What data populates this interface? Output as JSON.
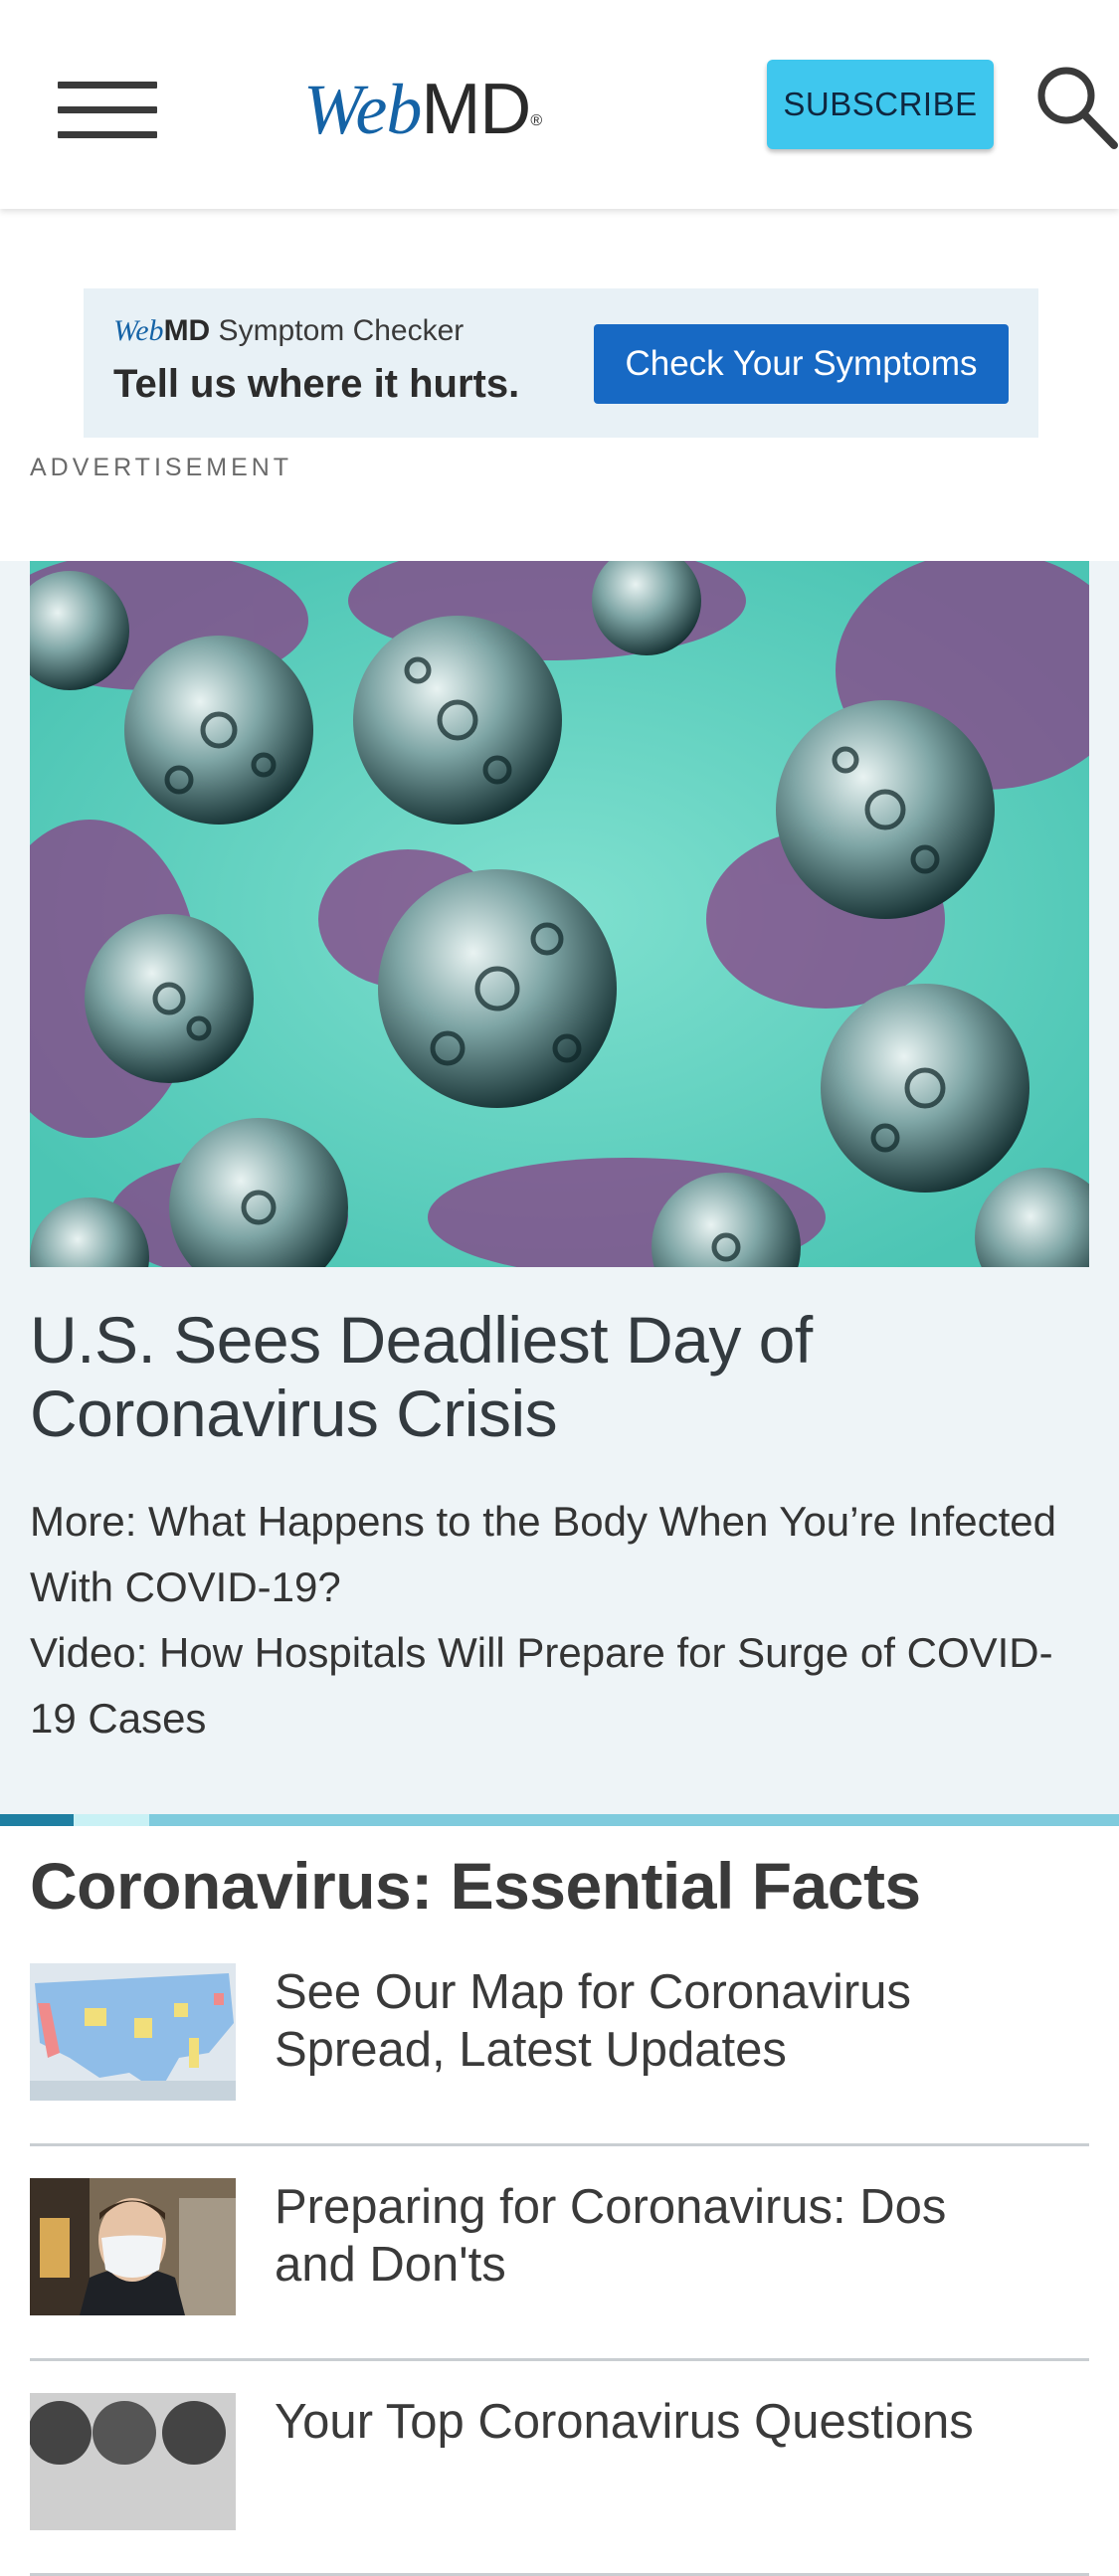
{
  "header": {
    "logo_web": "Web",
    "logo_md": "MD",
    "logo_reg": "®",
    "subscribe_label": "SUBSCRIBE"
  },
  "ad": {
    "brand_web": "Web",
    "brand_md": "MD",
    "brand_suffix": " Symptom Checker",
    "tagline": "Tell us where it hurts.",
    "cta": "Check Your Symptoms",
    "label": "ADVERTISEMENT"
  },
  "hero": {
    "title": "U.S. Sees Deadliest Day of Coronavirus Crisis",
    "links": [
      "More: What Happens to the Body When You’re Infected With COVID-19?",
      "Video: How Hospitals Will Prepare for Surge of COVID-19 Cases"
    ]
  },
  "essential_facts": {
    "title": "Coronavirus: Essential Facts",
    "items": [
      {
        "text": "See Our Map for Coronavirus Spread, Latest Updates"
      },
      {
        "text": "Preparing for Coronavirus: Dos and Don'ts"
      },
      {
        "text": "Your Top Coronavirus Questions"
      }
    ]
  },
  "colors": {
    "accent": "#3fc7ee",
    "brand_blue": "#1563a6",
    "cta_blue": "#1769c4",
    "hero_bg": "#eef4f7"
  }
}
